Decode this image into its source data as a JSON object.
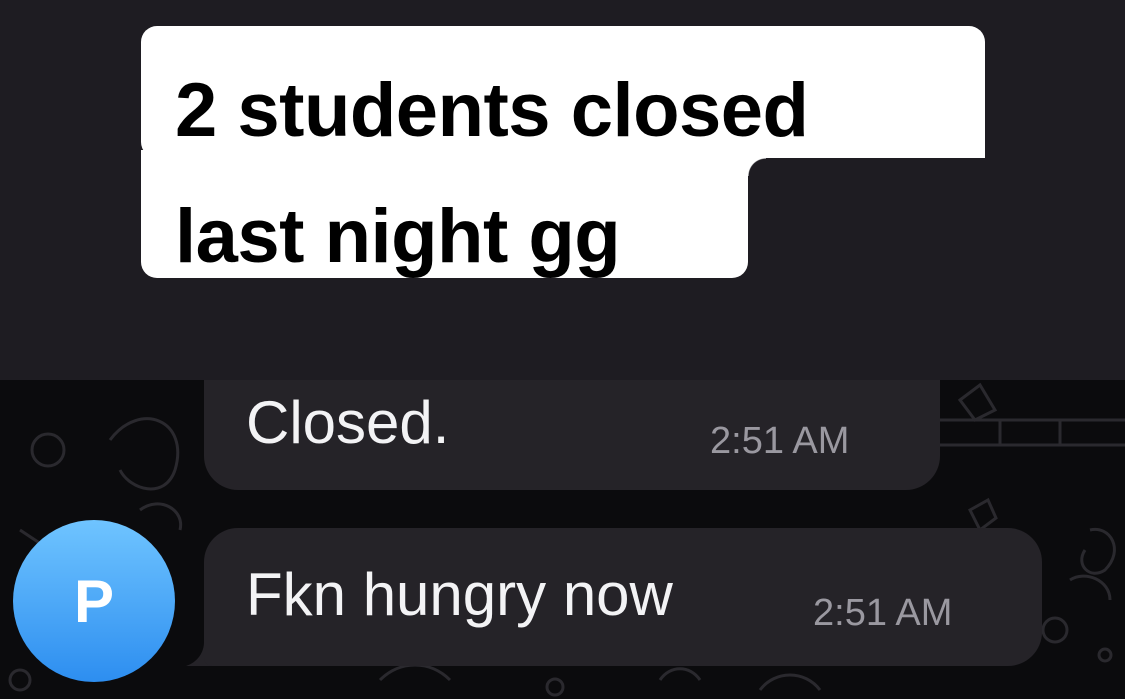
{
  "caption": {
    "line1": "2 students closed",
    "line2": "last night gg"
  },
  "messages": [
    {
      "text": "Closed.",
      "time": "2:51 AM"
    },
    {
      "text": "Fkn hungry now",
      "time": "2:51 AM"
    }
  ],
  "sender": {
    "initial": "P",
    "avatar_colors": [
      "#6fc4ff",
      "#2d8ef0"
    ]
  },
  "colors": {
    "caption_bg": "#1e1c22",
    "chat_bg": "#0b0b0d",
    "bubble_bg": "#252328",
    "timestamp": "#9a98a0"
  }
}
